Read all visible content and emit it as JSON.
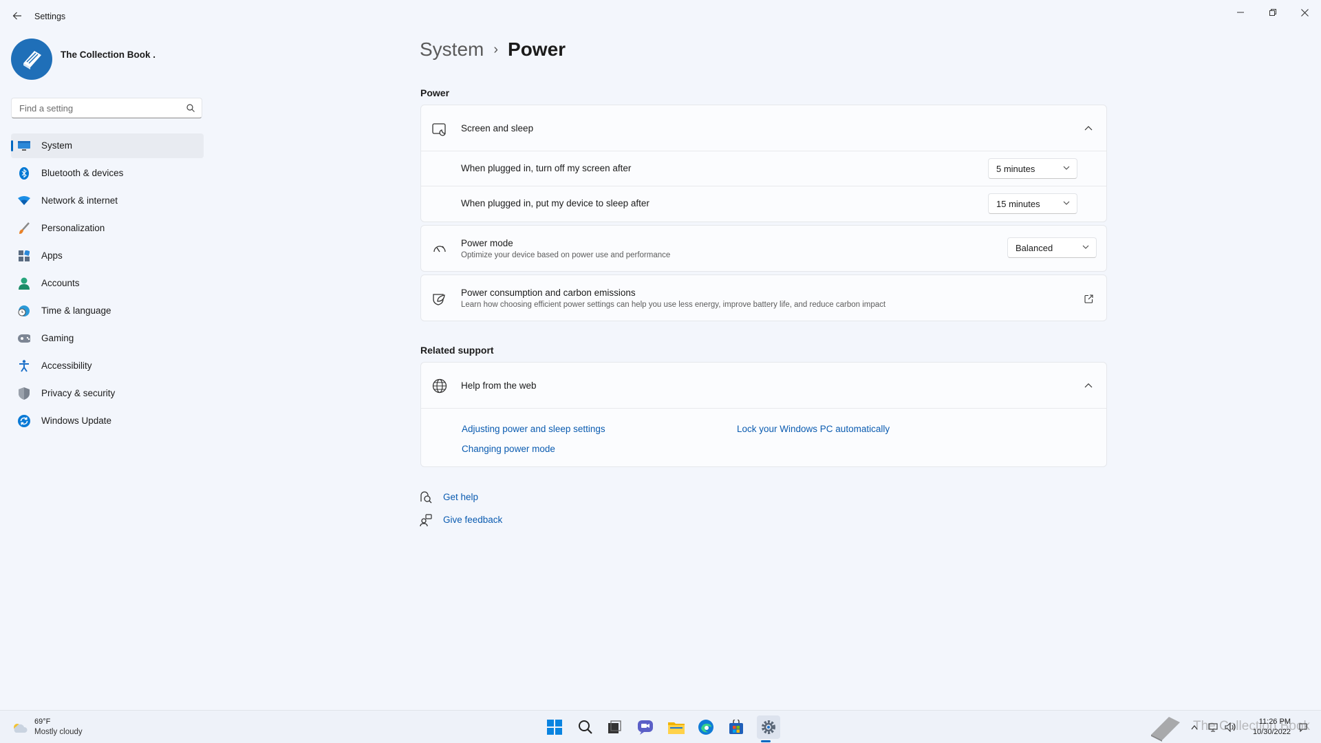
{
  "window": {
    "title": "Settings"
  },
  "profile": {
    "name": "The Collection Book ."
  },
  "search": {
    "placeholder": "Find a setting"
  },
  "sidebar": {
    "items": [
      {
        "label": "System",
        "icon": "monitor-icon",
        "active": true
      },
      {
        "label": "Bluetooth & devices",
        "icon": "bluetooth-icon"
      },
      {
        "label": "Network & internet",
        "icon": "wifi-icon"
      },
      {
        "label": "Personalization",
        "icon": "brush-icon"
      },
      {
        "label": "Apps",
        "icon": "apps-icon"
      },
      {
        "label": "Accounts",
        "icon": "person-icon"
      },
      {
        "label": "Time & language",
        "icon": "globe-clock-icon"
      },
      {
        "label": "Gaming",
        "icon": "gamepad-icon"
      },
      {
        "label": "Accessibility",
        "icon": "accessibility-icon"
      },
      {
        "label": "Privacy & security",
        "icon": "shield-icon"
      },
      {
        "label": "Windows Update",
        "icon": "update-icon"
      }
    ]
  },
  "breadcrumb": {
    "parent": "System",
    "current": "Power"
  },
  "power": {
    "section_title": "Power",
    "screen_sleep": {
      "title": "Screen and sleep",
      "screen_off_label": "When plugged in, turn off my screen after",
      "screen_off_value": "5 minutes",
      "sleep_label": "When plugged in, put my device to sleep after",
      "sleep_value": "15 minutes"
    },
    "power_mode": {
      "title": "Power mode",
      "subtitle": "Optimize your device based on power use and performance",
      "value": "Balanced"
    },
    "consumption": {
      "title": "Power consumption and carbon emissions",
      "subtitle": "Learn how choosing efficient power settings can help you use less energy, improve battery life, and reduce carbon impact"
    }
  },
  "related": {
    "section_title": "Related support",
    "help_title": "Help from the web",
    "links": [
      "Adjusting power and sleep settings",
      "Lock your Windows PC automatically",
      "Changing power mode"
    ]
  },
  "footer": {
    "get_help": "Get help",
    "give_feedback": "Give feedback"
  },
  "taskbar": {
    "weather_temp": "69°F",
    "weather_desc": "Mostly cloudy",
    "time": "11:26 PM",
    "date": "10/30/2022",
    "watermark": "The Collection Book"
  },
  "colors": {
    "accent": "#0067c0",
    "link": "#0a5bb0",
    "background": "#f3f6fc"
  }
}
